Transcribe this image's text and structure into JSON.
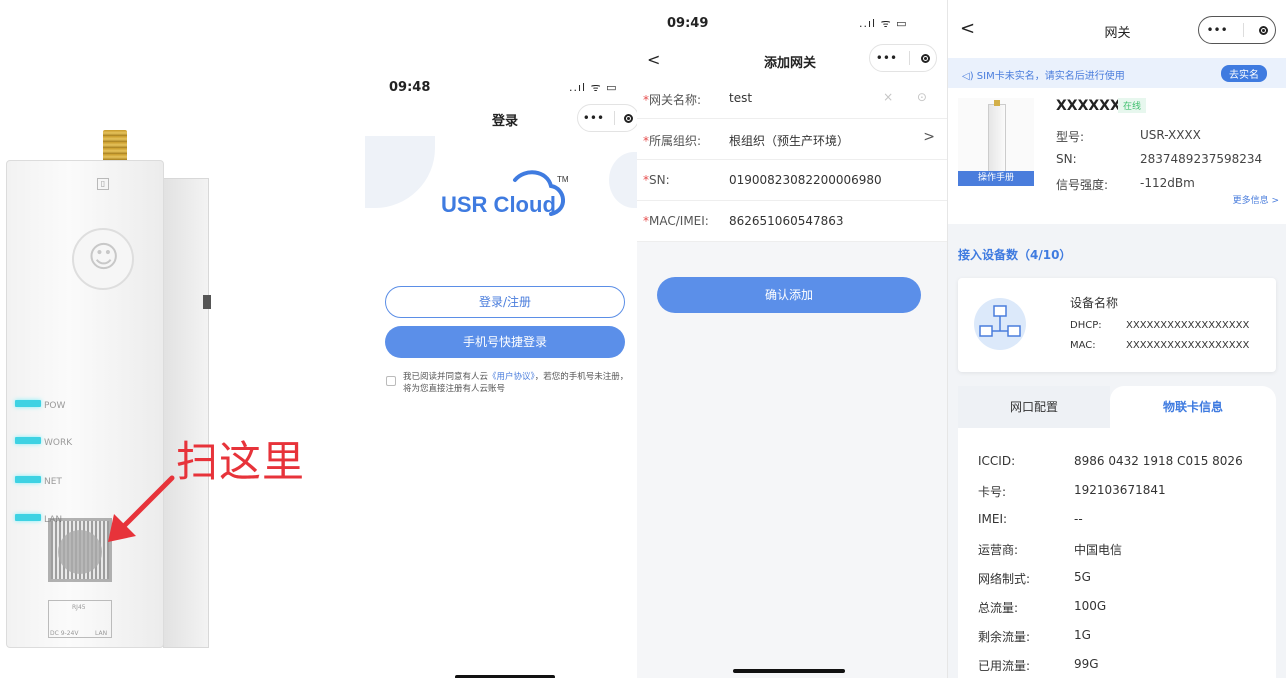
{
  "device_photo": {
    "leds": [
      "POW",
      "WORK",
      "NET",
      "LAN"
    ],
    "ports": [
      "RJ45",
      "DC 9-24V",
      "LAN"
    ],
    "scan_label": "扫这里"
  },
  "login": {
    "time": "09:48",
    "status_icons": "..ıl ᯤ ▭",
    "title": "登录",
    "brand": "USR Cloud",
    "trademark": "TM",
    "login_register_label": "登录/注册",
    "phone_login_label": "手机号快捷登录",
    "agreement_prefix": "我已阅读并同意有人云",
    "agreement_link": "《用户协议》",
    "agreement_suffix": "，若您的手机号未注册，将为您直接注册有人云账号",
    "capsule_more": "•••"
  },
  "add_gateway": {
    "time": "09:49",
    "status_icons": "..ıl ᯤ ▭",
    "back": "<",
    "title": "添加网关",
    "capsule_more": "•••",
    "fields": [
      {
        "required": "*",
        "label": "网关名称:",
        "value": "test",
        "suffix": "× ⊙"
      },
      {
        "required": "*",
        "label": "所属组织:",
        "value": "根组织（预生产环境）",
        "suffix": ">"
      },
      {
        "required": "*",
        "label": "SN:",
        "value": "01900823082200006980",
        "suffix": ""
      },
      {
        "required": "*",
        "label": "MAC/IMEI:",
        "value": "862651060547863",
        "suffix": ""
      }
    ],
    "confirm_label": "确认添加"
  },
  "gateway_detail": {
    "back": "<",
    "title": "网关",
    "capsule_more": "•••",
    "notice_text": "SIM卡未实名，请实名后进行使用",
    "notice_action": "去实名",
    "device_name": "XXXXXX",
    "online_badge": "在线",
    "manual_label": "操作手册",
    "specs": [
      {
        "k": "型号:",
        "v": "USR-XXXX"
      },
      {
        "k": "SN:",
        "v": "2837489237598234"
      },
      {
        "k": "信号强度:",
        "v": "-112dBm"
      }
    ],
    "more_info": "更多信息 >",
    "connected_title": "接入设备数（4/10）",
    "connected_device": {
      "name": "设备名称",
      "rows": [
        {
          "k": "DHCP:",
          "v": "XXXXXXXXXXXXXXXXXX"
        },
        {
          "k": "MAC:",
          "v": "XXXXXXXXXXXXXXXXXX"
        }
      ]
    },
    "tabs": [
      "网口配置",
      "物联卡信息"
    ],
    "active_tab": "物联卡信息",
    "card_info": [
      {
        "k": "ICCID:",
        "v": "8986 0432 1918 C015 8026"
      },
      {
        "k": "卡号:",
        "v": "192103671841"
      },
      {
        "k": "IMEI:",
        "v": "--"
      },
      {
        "k": "运营商:",
        "v": "中国电信"
      },
      {
        "k": "网络制式:",
        "v": "5G"
      },
      {
        "k": "总流量:",
        "v": "100G"
      },
      {
        "k": "剩余流量:",
        "v": "1G"
      },
      {
        "k": "已用流量:",
        "v": "99G"
      }
    ]
  },
  "colors": {
    "primary": "#5b8fe9",
    "accent_blue": "#3f7be0",
    "scan_red": "#e7333a",
    "led_cyan": "#3ed2e3",
    "required_red": "#e64d4d",
    "online_green": "#3fbf6e"
  }
}
